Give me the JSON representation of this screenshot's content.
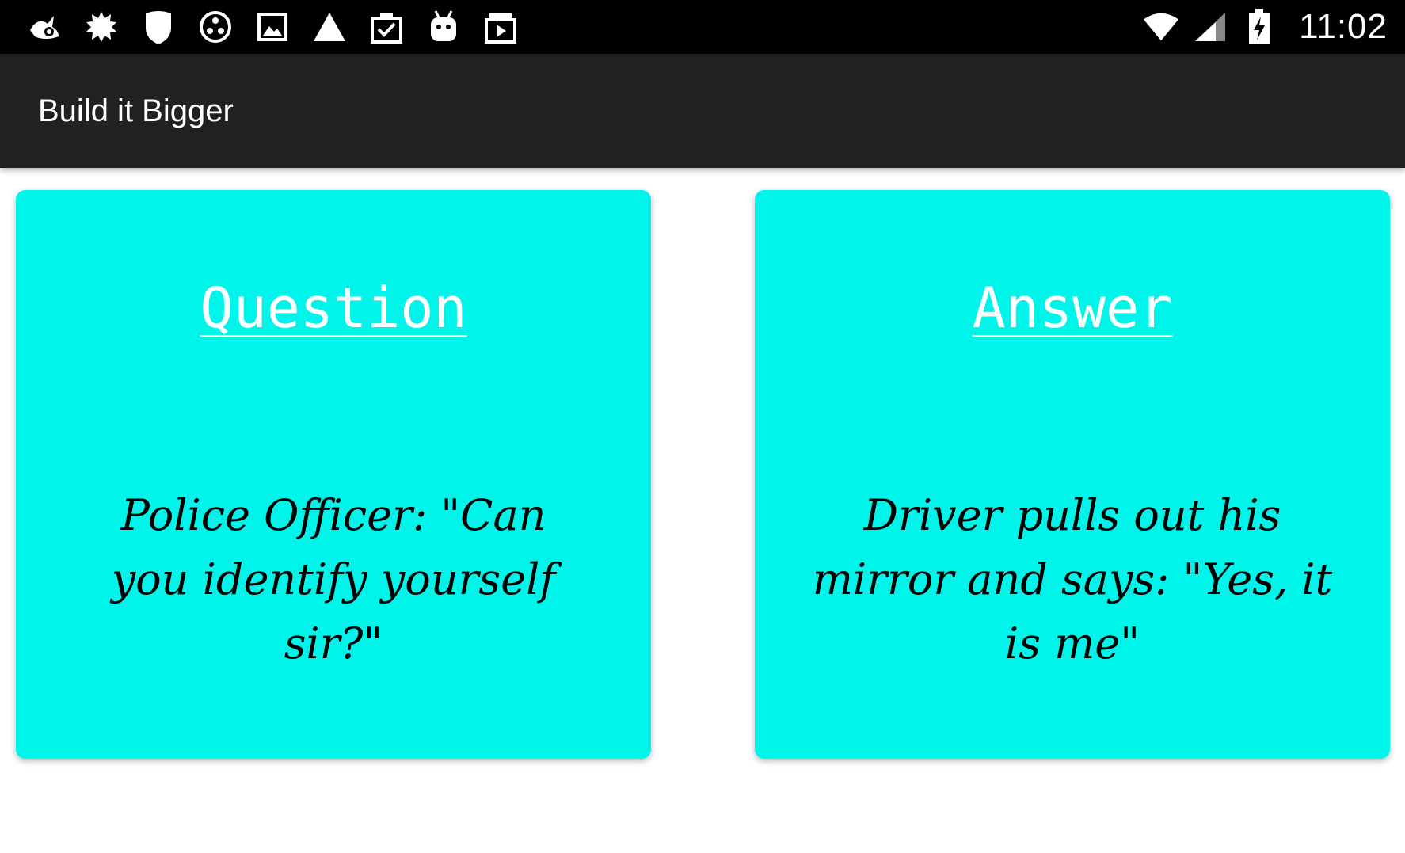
{
  "status_bar": {
    "time": "11:02",
    "left_icons": [
      "bird-icon",
      "burst-icon",
      "shield-icon",
      "circles-icon",
      "image-icon",
      "warning-triangle-icon",
      "clipboard-check-icon",
      "android-icon",
      "play-folder-icon"
    ],
    "right_icons": [
      "wifi-icon",
      "signal-icon",
      "battery-charging-icon"
    ]
  },
  "app_bar": {
    "title": "Build it Bigger"
  },
  "question_card": {
    "heading": "Question",
    "text": "Police Officer: \"Can you identify yourself sir?\""
  },
  "answer_card": {
    "heading": "Answer",
    "text": "Driver pulls out his mirror and says: \"Yes, it is me\""
  },
  "colors": {
    "card_background": "#00f5ea",
    "app_bar": "#212121",
    "status_bar": "#000000"
  }
}
